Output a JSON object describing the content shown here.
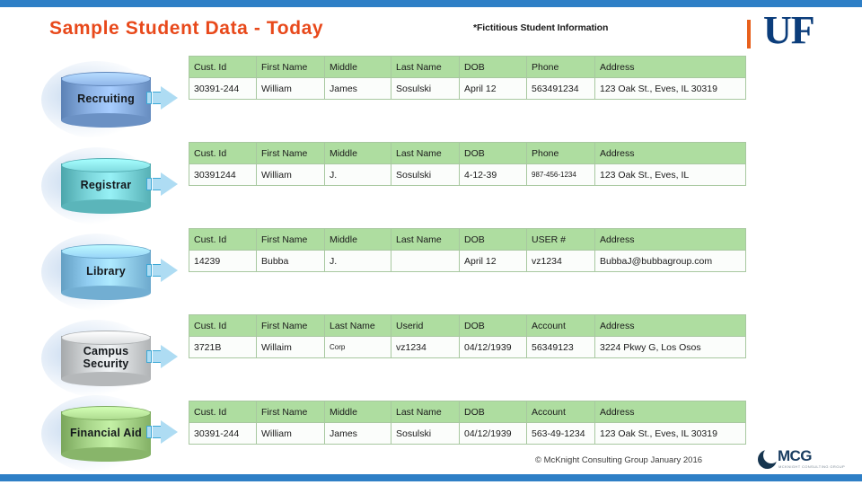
{
  "slide": {
    "title": "Sample Student Data - Today",
    "subtitle": "*Fictitious Student Information",
    "accent_bar_color": "#2E7FC6",
    "title_color": "#E8491B",
    "header_row_color": "#AEDDA0"
  },
  "uf_logo": {
    "text": "UF",
    "bar_color": "#E8601C",
    "text_color": "#0B3D7B"
  },
  "footer": {
    "copyright": "© McKnight Consulting Group January 2016",
    "logo_text": "MCG",
    "logo_tagline": "MCKNIGHT CONSULTING GROUP"
  },
  "systems": [
    {
      "name": "Recruiting",
      "cylinder_color": "#7FA5D8",
      "table": {
        "headers": [
          "Cust. Id",
          "First Name",
          "Middle",
          "Last Name",
          "DOB",
          "Phone",
          "Address"
        ],
        "rows": [
          {
            "cells": [
              "30391-244",
              "William",
              "James",
              "Sosulski",
              "April 12",
              "563491234",
              "123 Oak St., Eves, IL 30319"
            ],
            "small": [
              false,
              false,
              false,
              false,
              false,
              false,
              false
            ]
          }
        ]
      }
    },
    {
      "name": "Registrar",
      "cylinder_color": "#6FC9CE",
      "table": {
        "headers": [
          "Cust. Id",
          "First Name",
          "Middle",
          "Last Name",
          "DOB",
          "Phone",
          "Address"
        ],
        "rows": [
          {
            "cells": [
              "30391244",
              "William",
              "J.",
              "Sosulski",
              "4-12-39",
              "987-456-1234",
              "123 Oak St., Eves, IL"
            ],
            "small": [
              false,
              false,
              false,
              false,
              false,
              true,
              false
            ]
          }
        ]
      }
    },
    {
      "name": "Library",
      "cylinder_color": "#86C2E6",
      "table": {
        "headers": [
          "Cust. Id",
          "First Name",
          "Middle",
          "Last Name",
          "DOB",
          "USER #",
          "Address"
        ],
        "rows": [
          {
            "cells": [
              "14239",
              "Bubba",
              "J.",
              "",
              "April 12",
              "vz1234",
              "BubbaJ@bubbagroup.com"
            ],
            "small": [
              false,
              false,
              false,
              false,
              false,
              false,
              false
            ]
          }
        ]
      }
    },
    {
      "name": "Campus Security",
      "cylinder_color": "#C9CCCE",
      "table": {
        "headers": [
          "Cust. Id",
          "First Name",
          "Last Name",
          "Userid",
          "DOB",
          "Account",
          "Address"
        ],
        "rows": [
          {
            "cells": [
              "3721B",
              "Willaim",
              "Corp",
              "vz1234",
              "04/12/1939",
              "56349123",
              "3224 Pkwy G, Los Osos"
            ],
            "small": [
              false,
              false,
              true,
              false,
              false,
              false,
              false
            ]
          }
        ]
      }
    },
    {
      "name": "Financial Aid",
      "cylinder_color": "#9CC97E",
      "table": {
        "headers": [
          "Cust. Id",
          "First Name",
          "Middle",
          "Last Name",
          "DOB",
          "Account",
          "Address"
        ],
        "rows": [
          {
            "cells": [
              "30391-244",
              "William",
              "James",
              "Sosulski",
              "04/12/1939",
              "563-49-1234",
              "123 Oak St., Eves, IL 30319"
            ],
            "small": [
              false,
              false,
              false,
              false,
              false,
              false,
              false
            ]
          }
        ]
      }
    }
  ]
}
